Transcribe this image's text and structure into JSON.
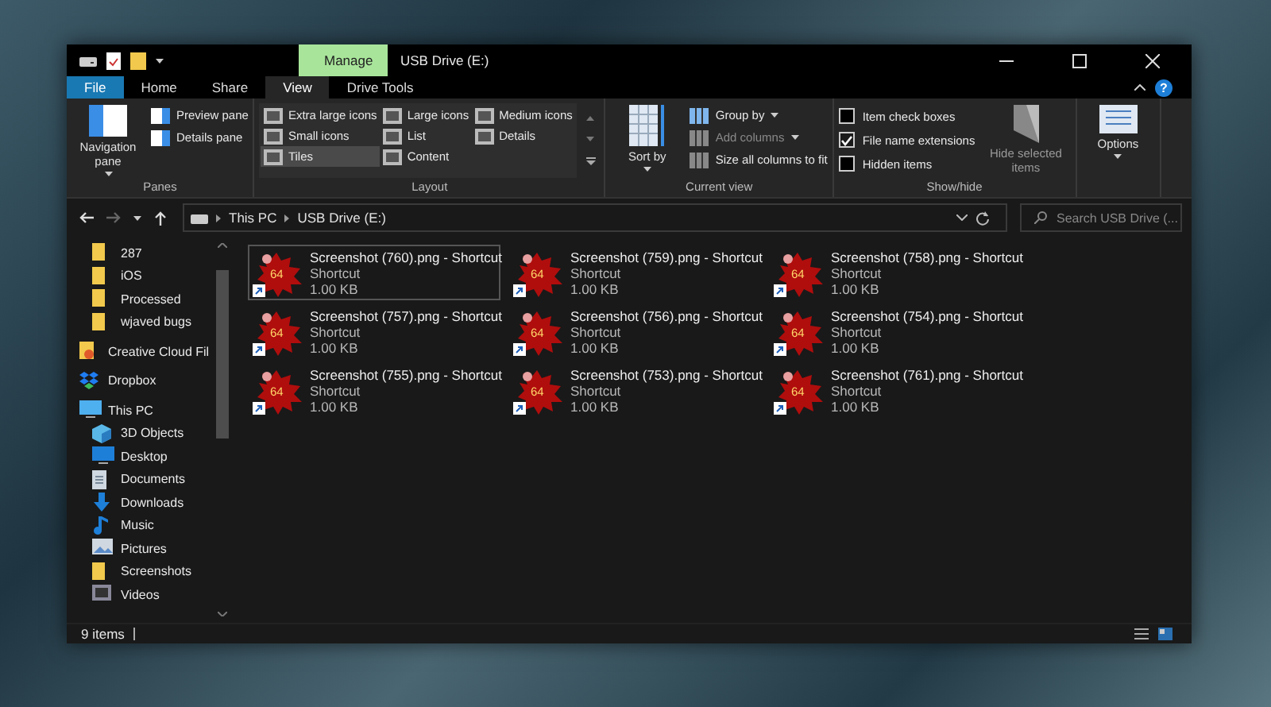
{
  "window": {
    "title": "USB Drive (E:)",
    "context_tab": "Manage",
    "help": "?"
  },
  "tabs": [
    {
      "label": "File",
      "kind": "file",
      "selected": false
    },
    {
      "label": "Home",
      "kind": "tab",
      "selected": false
    },
    {
      "label": "Share",
      "kind": "tab",
      "selected": false
    },
    {
      "label": "View",
      "kind": "tab",
      "selected": true
    },
    {
      "label": "Drive Tools",
      "kind": "tab",
      "selected": false
    }
  ],
  "ribbon": {
    "panes": {
      "label": "Panes",
      "large": "Navigation pane",
      "items": [
        "Preview pane",
        "Details pane"
      ]
    },
    "layout": {
      "label": "Layout",
      "options": [
        {
          "label": "Extra large icons",
          "selected": false
        },
        {
          "label": "Large icons",
          "selected": false
        },
        {
          "label": "Medium icons",
          "selected": false
        },
        {
          "label": "Small icons",
          "selected": false
        },
        {
          "label": "List",
          "selected": false
        },
        {
          "label": "Details",
          "selected": false
        },
        {
          "label": "Tiles",
          "selected": true
        },
        {
          "label": "Content",
          "selected": false
        }
      ]
    },
    "current_view": {
      "label": "Current view",
      "large": "Sort by",
      "items": [
        {
          "label": "Group by",
          "disabled": false
        },
        {
          "label": "Add columns",
          "disabled": true
        },
        {
          "label": "Size all columns to fit",
          "disabled": false
        }
      ]
    },
    "show_hide": {
      "label": "Show/hide",
      "checkboxes": [
        {
          "label": "Item check boxes",
          "checked": false
        },
        {
          "label": "File name extensions",
          "checked": true
        },
        {
          "label": "Hidden items",
          "checked": false
        }
      ],
      "large": "Hide selected items"
    },
    "options": {
      "large": "Options"
    }
  },
  "address": {
    "path": [
      "This PC",
      "USB Drive (E:)"
    ],
    "search_placeholder": "Search USB Drive (..."
  },
  "sidebar": {
    "items": [
      {
        "label": "287",
        "kind": "folder"
      },
      {
        "label": "iOS",
        "kind": "folder"
      },
      {
        "label": "Processed",
        "kind": "folder"
      },
      {
        "label": "wjaved bugs",
        "kind": "folder"
      },
      {
        "label": "Creative Cloud Fil",
        "kind": "cloud"
      },
      {
        "label": "Dropbox",
        "kind": "dropbox"
      },
      {
        "label": "This PC",
        "kind": "pc",
        "children": [
          {
            "label": "3D Objects",
            "kind": "objects"
          },
          {
            "label": "Desktop",
            "kind": "desktop"
          },
          {
            "label": "Documents",
            "kind": "documents"
          },
          {
            "label": "Downloads",
            "kind": "downloads"
          },
          {
            "label": "Music",
            "kind": "music"
          },
          {
            "label": "Pictures",
            "kind": "pictures"
          },
          {
            "label": "Screenshots",
            "kind": "folder"
          },
          {
            "label": "Videos",
            "kind": "videos"
          }
        ]
      }
    ]
  },
  "files": [
    {
      "name": "Screenshot (760).png - Shortcut",
      "type": "Shortcut",
      "size": "1.00 KB",
      "icon_text": "64",
      "selected": true
    },
    {
      "name": "Screenshot (759).png - Shortcut",
      "type": "Shortcut",
      "size": "1.00 KB",
      "icon_text": "64",
      "selected": false
    },
    {
      "name": "Screenshot (758).png - Shortcut",
      "type": "Shortcut",
      "size": "1.00 KB",
      "icon_text": "64",
      "selected": false
    },
    {
      "name": "Screenshot (757).png - Shortcut",
      "type": "Shortcut",
      "size": "1.00 KB",
      "icon_text": "64",
      "selected": false
    },
    {
      "name": "Screenshot (756).png - Shortcut",
      "type": "Shortcut",
      "size": "1.00 KB",
      "icon_text": "64",
      "selected": false
    },
    {
      "name": "Screenshot (754).png - Shortcut",
      "type": "Shortcut",
      "size": "1.00 KB",
      "icon_text": "64",
      "selected": false
    },
    {
      "name": "Screenshot (755).png - Shortcut",
      "type": "Shortcut",
      "size": "1.00 KB",
      "icon_text": "64",
      "selected": false
    },
    {
      "name": "Screenshot (753).png - Shortcut",
      "type": "Shortcut",
      "size": "1.00 KB",
      "icon_text": "64",
      "selected": false
    },
    {
      "name": "Screenshot (761).png - Shortcut",
      "type": "Shortcut",
      "size": "1.00 KB",
      "icon_text": "64",
      "selected": false
    }
  ],
  "status_bar": {
    "count": "9 items"
  }
}
